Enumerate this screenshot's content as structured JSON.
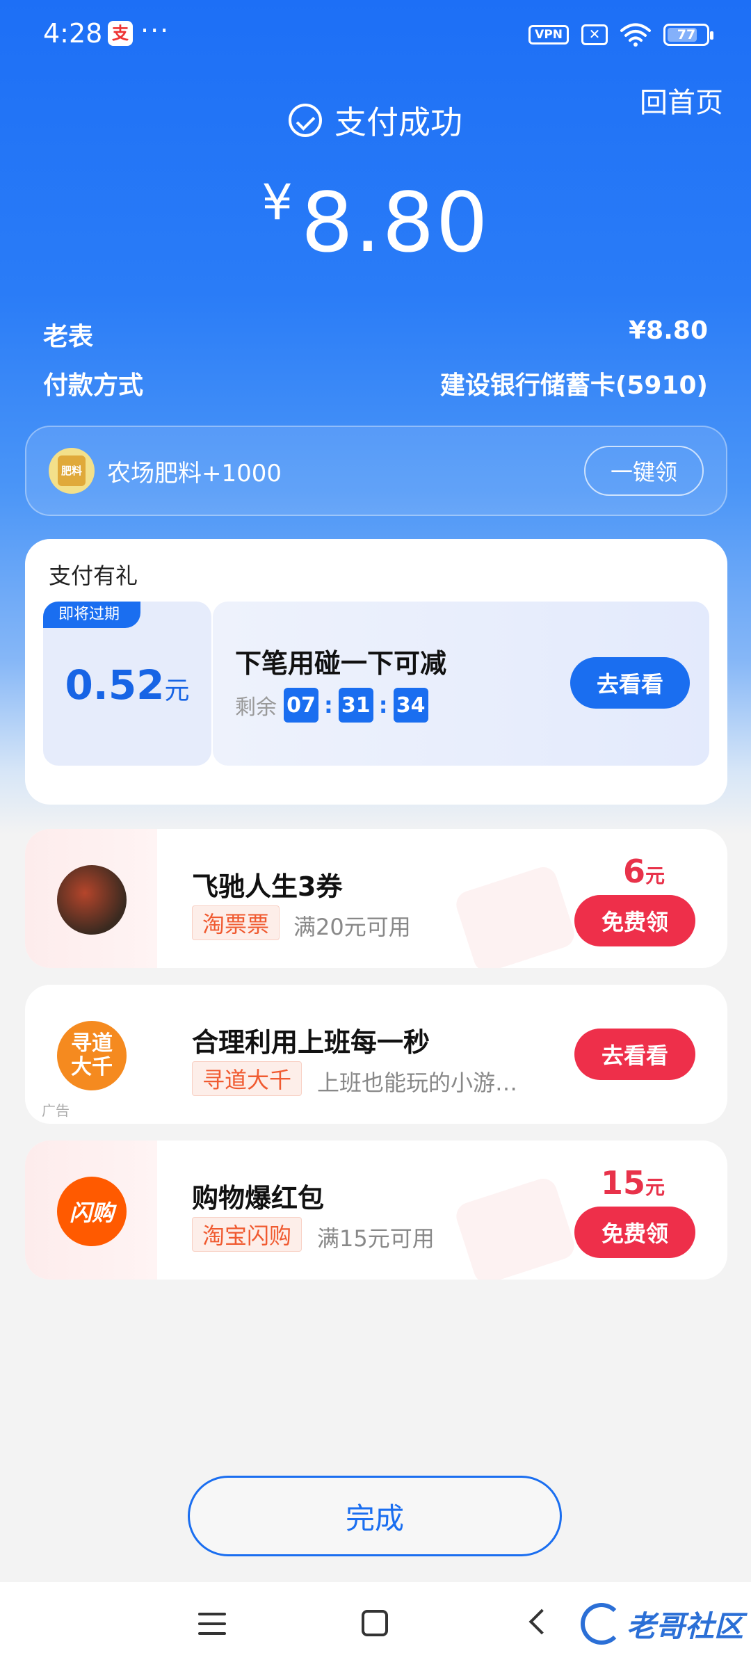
{
  "status_bar": {
    "time": "4:28",
    "app_badge": "支",
    "dots": "···",
    "vpn": "VPN",
    "sim": "✕",
    "battery": "77",
    "battery_level": 0.77
  },
  "header": {
    "home_link": "回首页",
    "status_text": "支付成功",
    "currency": "¥",
    "amount": "8.80"
  },
  "details": {
    "merchant_label": "老表",
    "merchant_value": "¥8.80",
    "method_label": "付款方式",
    "method_value": "建设银行储蓄卡(5910)"
  },
  "farm": {
    "icon_text": "肥料",
    "text": "农场肥料+1000",
    "button": "一键领"
  },
  "gift": {
    "title": "支付有礼",
    "expire_tag": "即将过期",
    "value": "0.52",
    "unit": "元",
    "desc": "下笔用碰一下可减",
    "remain_label": "剩余",
    "hh": "07",
    "mm": "31",
    "ss": "34",
    "colon": ":",
    "button": "去看看"
  },
  "promos": [
    {
      "title": "飞驰人生3券",
      "tag": "淘票票",
      "sub": "满20元可用",
      "price": "6",
      "unit": "元",
      "button": "免费领",
      "icon_color": "#3a2a20"
    },
    {
      "title": "合理利用上班每一秒",
      "tag": "寻道大千",
      "sub": "上班也能玩的小游…",
      "button": "去看看",
      "ad_label": "广告",
      "icon_text": "寻道\n大千",
      "icon_color": "#f58a1f"
    },
    {
      "title": "购物爆红包",
      "tag": "淘宝闪购",
      "sub": "满15元可用",
      "price": "15",
      "unit": "元",
      "button": "免费领",
      "icon_text": "闪购",
      "icon_color": "#ff5a00"
    }
  ],
  "done_button": "完成",
  "watermark": "老哥社区",
  "colors": {
    "primary_blue": "#1a6ef0",
    "promo_red": "#ee2f4a",
    "tag_orange": "#f05a30"
  }
}
